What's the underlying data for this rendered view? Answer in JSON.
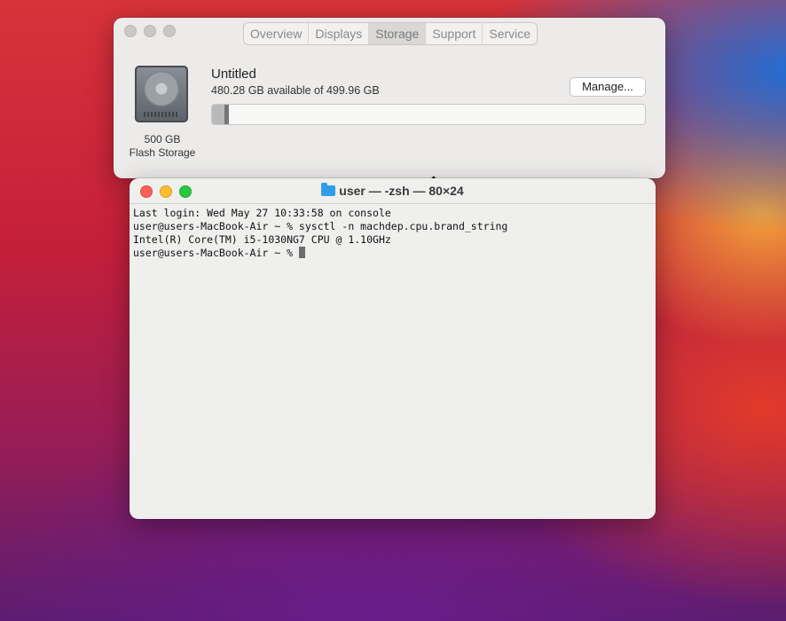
{
  "about_window": {
    "tabs": [
      {
        "label": "Overview",
        "active": false
      },
      {
        "label": "Displays",
        "active": false
      },
      {
        "label": "Storage",
        "active": true
      },
      {
        "label": "Support",
        "active": false
      },
      {
        "label": "Service",
        "active": false
      }
    ],
    "drive_icon": "hard-drive-icon",
    "capacity": "500 GB",
    "storage_type": "Flash Storage",
    "volume_name": "Untitled",
    "available_text": "480.28 GB available of 499.96 GB",
    "manage_label": "Manage...",
    "used_fraction": 0.039
  },
  "terminal_window": {
    "title": "user — -zsh — 80×24",
    "lines": [
      "Last login: Wed May 27 10:33:58 on console",
      "user@users-MacBook-Air ~ % sysctl -n machdep.cpu.brand_string",
      "Intel(R) Core(TM) i5-1030NG7 CPU @ 1.10GHz"
    ],
    "prompt": "user@users-MacBook-Air ~ % "
  },
  "colors": {
    "close": "#fe5f57",
    "minimize": "#febc2e",
    "zoom": "#28c840",
    "folder": "#2f9ee8"
  }
}
